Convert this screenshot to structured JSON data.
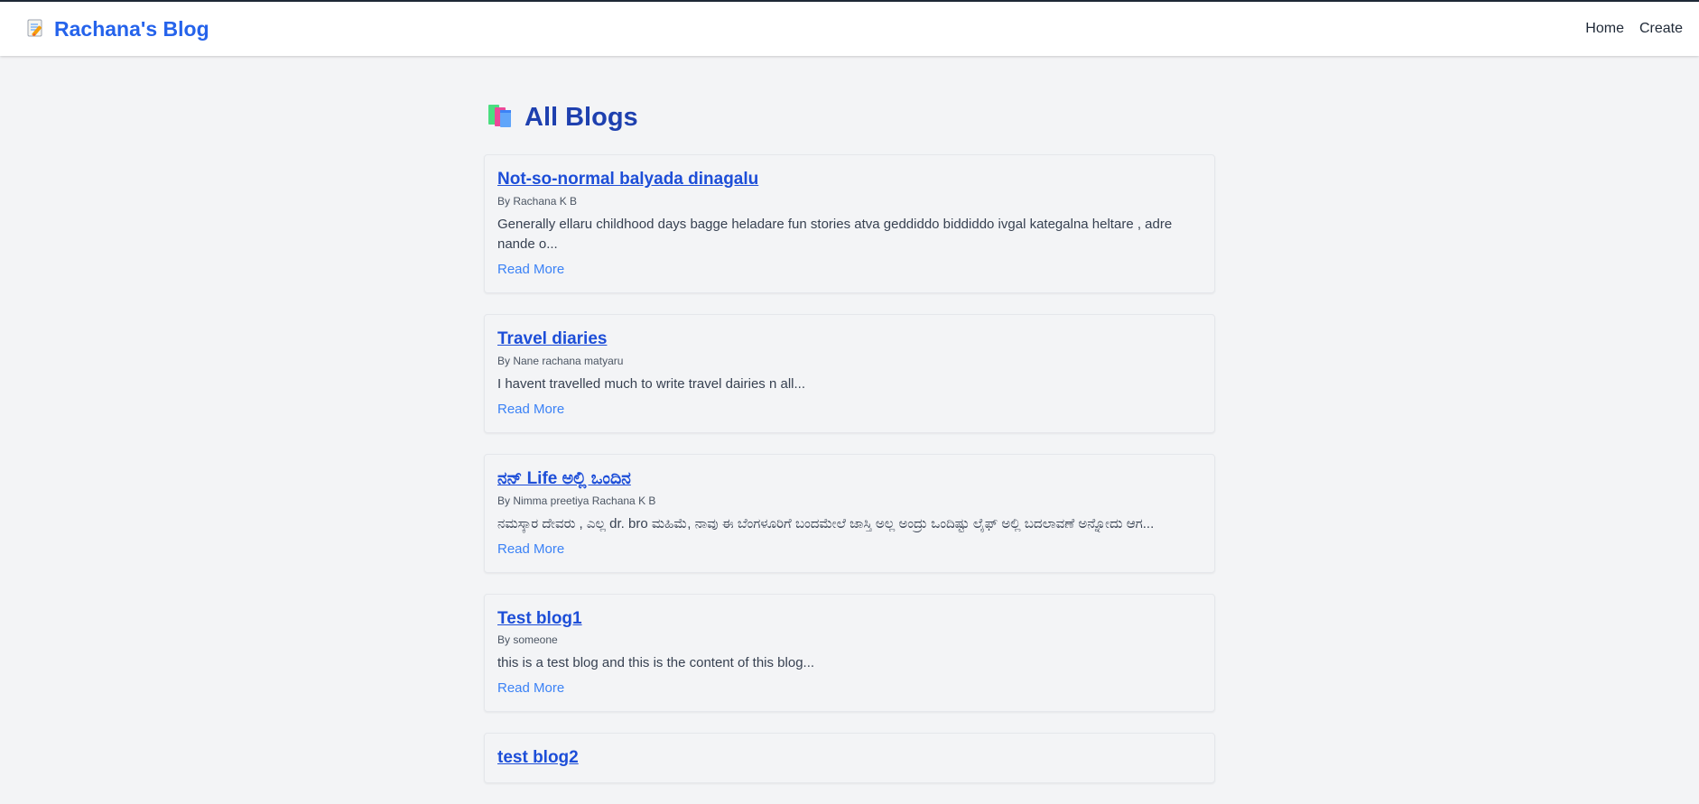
{
  "brand": {
    "icon": "memo-icon",
    "title": "Rachana's Blog"
  },
  "nav": {
    "links": [
      "Home",
      "Create"
    ]
  },
  "page": {
    "icon": "books-icon",
    "title": "All Blogs"
  },
  "posts": [
    {
      "title": "Not-so-normal balyada dinagalu",
      "author": "By Rachana K B",
      "excerpt": "Generally ellaru childhood days bagge heladare fun stories atva geddiddo biddiddo ivgal kategalna heltare , adre nande o...",
      "link": "Read More"
    },
    {
      "title": "Travel diaries",
      "author": "By Nane rachana matyaru",
      "excerpt": "I havent travelled much to write travel dairies n all...",
      "link": "Read More"
    },
    {
      "title": "ನನ್ Life ಅಲ್ಲಿ ಒಂದಿನ",
      "author": "By Nimma preetiya Rachana K B",
      "excerpt": "ನಮಸ್ಕಾರ ದೇವರು , ಎಲ್ಲ dr. bro ಮಹಿಮೆ, ನಾವು ಈ ಬೆಂಗಳೂರಿಗೆ ಬಂದಮೇಲೆ ಜಾಸ್ತಿ ಅಲ್ಲ ಅಂದ್ರು ಒಂದಿಷ್ಟು ಲೈಫ್ ಅಲ್ಲಿ ಬದಲಾವಣೆ ಅನ್ನೋದು ಆಗ...",
      "link": "Read More"
    },
    {
      "title": "Test blog1",
      "author": "By someone",
      "excerpt": "this is a test blog and this is the content of this blog...",
      "link": "Read More"
    },
    {
      "title": "test blog2",
      "author": "",
      "excerpt": "",
      "link": ""
    }
  ],
  "colors": {
    "accent": "#2563eb",
    "title": "#1e40af",
    "link": "#3b82f6",
    "background": "#f3f4f6"
  }
}
